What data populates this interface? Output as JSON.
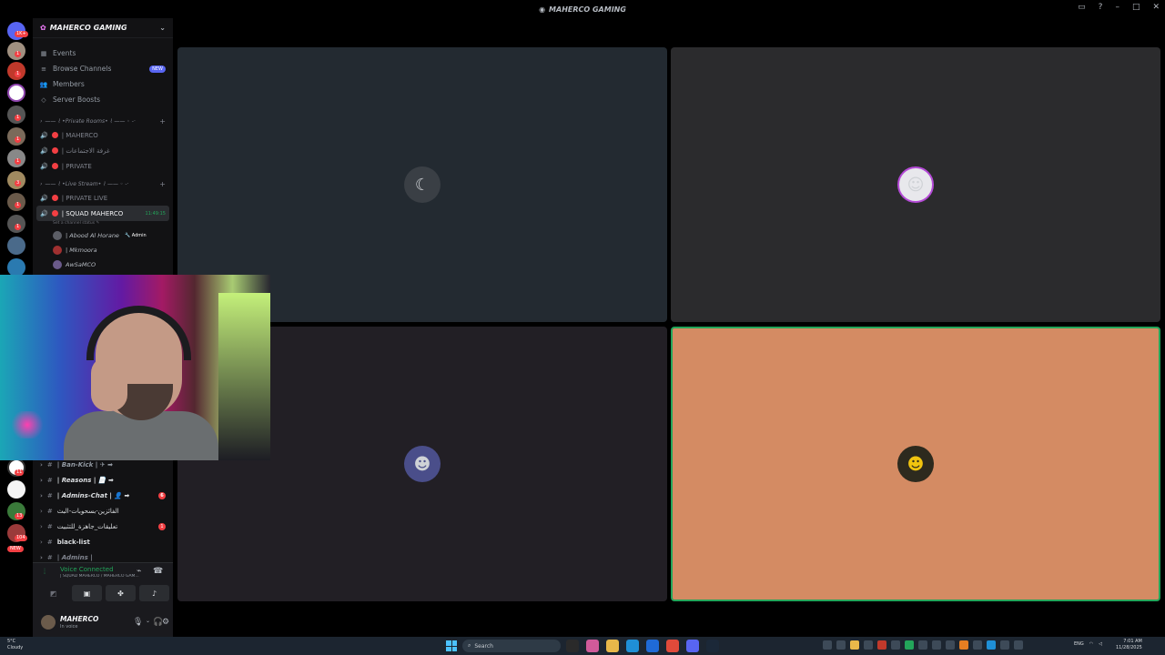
{
  "window": {
    "title": "MAHERCO GAMING"
  },
  "rail": {
    "badges": [
      "1K+",
      "1",
      "1",
      "1",
      "1",
      "1",
      "3",
      "1",
      "1",
      "11",
      "1",
      "13",
      "104",
      "NEW"
    ]
  },
  "sidebar": {
    "guild_name": "MAHERCO GAMING",
    "nav": {
      "events": "Events",
      "browse_channels": "Browse Channels",
      "browse_new": "NEW",
      "members": "Members",
      "server_boosts": "Server Boosts"
    },
    "categories": {
      "private_rooms": "—— ⌇ •Private Rooms• ⌇ —— ◦ -·",
      "live_stream": "—— ⌇ •Live Stream• ⌇ —— ◦ -·"
    },
    "voice_channels": [
      {
        "name": "| MAHERCO"
      },
      {
        "name": "| غرفة الاجتماعات"
      },
      {
        "name": "| PRIVATE"
      },
      {
        "name": "| PRIVATE LIVE"
      },
      {
        "name": "| SQUAD MAHERCO",
        "time": "11:49:15",
        "status": "Set a channel status ✎"
      }
    ],
    "members": [
      {
        "name": "| Abood Al Horane",
        "tag": "🔧 Admin"
      },
      {
        "name": "| Mkmoora"
      },
      {
        "name": "AwSaMCO"
      }
    ],
    "text_channels": [
      {
        "name": "| Ban-Kick | ✈ ➡",
        "unread": ""
      },
      {
        "name": "| Reasons | 📄 ➡",
        "unread": ""
      },
      {
        "name": "| Admins-Chat | 👤 ➡",
        "unread": "6"
      },
      {
        "name": "الفائزين-بسحوبات-البث",
        "unread": ""
      },
      {
        "name": "تعليقات_جاهزة_للتثبيت",
        "unread": "1"
      },
      {
        "name": "black-list",
        "unread": ""
      },
      {
        "name": "| Admins |",
        "unread": ""
      }
    ]
  },
  "voice_panel": {
    "status": "Voice Connected",
    "subtitle": "| SQUAD MAHERCO / MAHERCO GAM..."
  },
  "user_panel": {
    "username": "MAHERCO",
    "status": "In voice"
  },
  "taskbar": {
    "weather_temp": "5°C",
    "weather_desc": "Cloudy",
    "search_placeholder": "Search",
    "lang": "ENG",
    "time": "7:01 AM",
    "date": "11/28/2025"
  }
}
